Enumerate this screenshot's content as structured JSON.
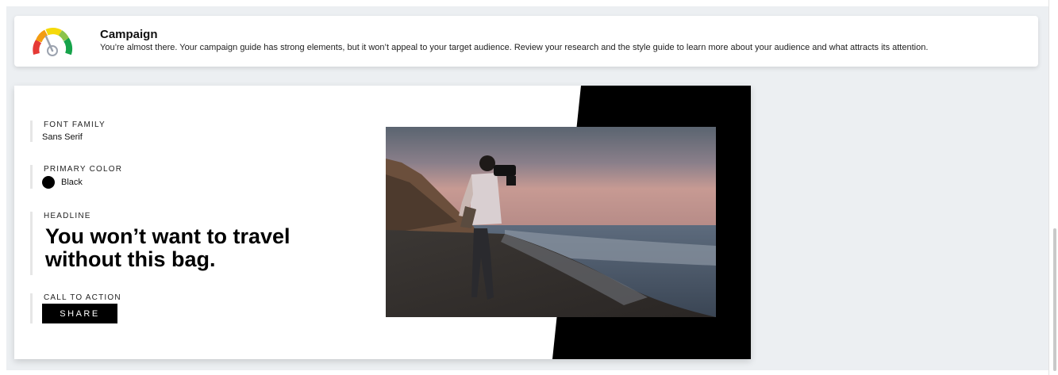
{
  "banner": {
    "title": "Campaign",
    "message": "You’re almost there. Your campaign guide has strong elements, but it won’t appeal to your target audience. Review your research and the style guide to learn more about your audience and what attracts its attention.",
    "gauge_colors": [
      "#e53935",
      "#f39c12",
      "#f5d90a",
      "#8bc34a",
      "#16a34a"
    ]
  },
  "style_guide": {
    "font_family": {
      "label": "FONT FAMILY",
      "value": "Sans Serif"
    },
    "primary_color": {
      "label": "PRIMARY COLOR",
      "value": "Black",
      "hex": "#000000"
    },
    "headline": {
      "label": "HEADLINE",
      "value": "You won’t want to travel without this bag."
    },
    "call_to_action": {
      "label": "CALL TO ACTION",
      "button_label": "SHARE"
    }
  }
}
